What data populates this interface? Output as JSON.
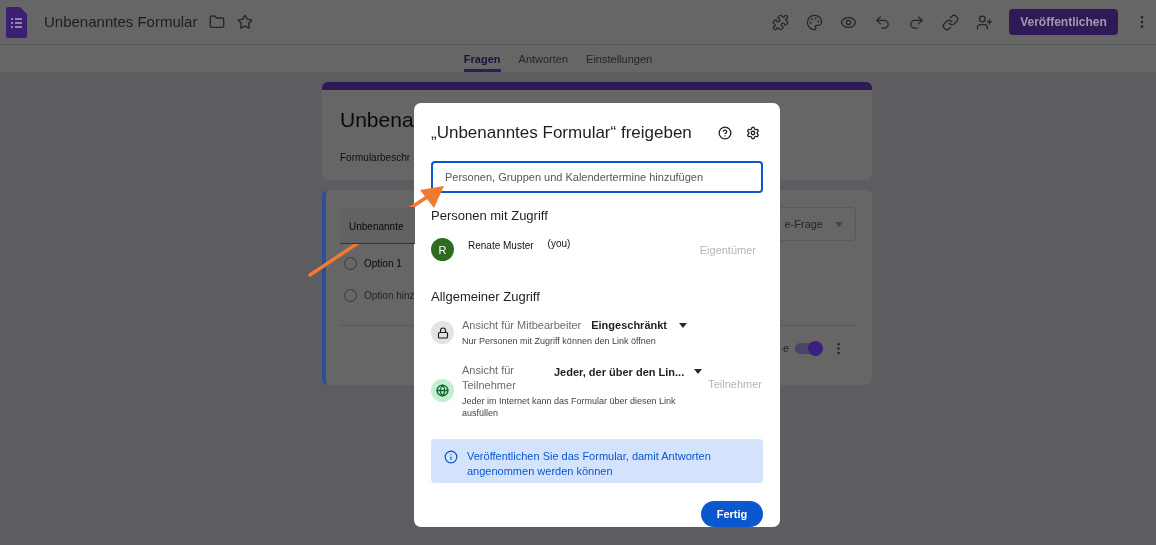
{
  "app_bar": {
    "title": "Unbenanntes Formular",
    "publish_button": "Veröffentlichen"
  },
  "tabs": [
    {
      "label": "Fragen",
      "selected": true
    },
    {
      "label": "Antworten",
      "selected": false
    },
    {
      "label": "Einstellungen",
      "selected": false
    }
  ],
  "form_header": {
    "title": "Unbena",
    "description": "Formularbeschr"
  },
  "question": {
    "title": "Unbenannte",
    "type": "e-Frage",
    "required_label": "e",
    "required": true,
    "options": [
      {
        "label": "Option 1",
        "kind": "option"
      },
      {
        "label": "Option hinz",
        "kind": "add"
      }
    ]
  },
  "share_dialog": {
    "title": "„Unbenanntes Formular“ freigeben",
    "search": {
      "placeholder": "Personen, Gruppen und Kalendertermine hinzufügen"
    },
    "people_heading": "Personen mit Zugriff",
    "people": [
      {
        "initial": "R",
        "name": "Renate Muster",
        "note": "(you)",
        "role": "Eigentümer"
      }
    ],
    "general_heading": "Allgemeiner Zugriff",
    "access": [
      {
        "kind": "restricted",
        "label": "Ansicht für Mitbearbeiter",
        "value": "Eingeschränkt",
        "description": "Nur Personen mit Zugriff können den Link öffnen"
      },
      {
        "kind": "public",
        "label": "Ansicht für Teilnehmer",
        "value": "Jeder, der über den Lin...",
        "role": "Teilnehmer",
        "description": "Jeder im Internet kann das Formular über diesen Link ausfüllen"
      }
    ],
    "notice": "Veröffentlichen Sie das Formular, damit Antworten angenommen werden können",
    "done_button": "Fertig"
  }
}
